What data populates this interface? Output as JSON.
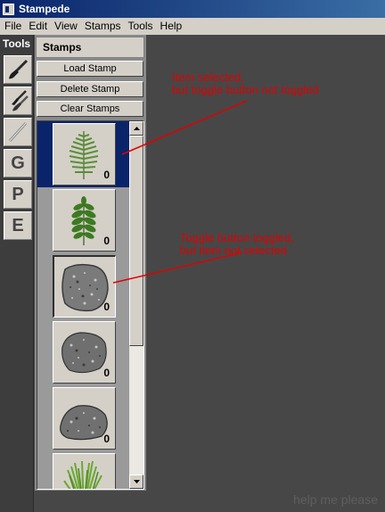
{
  "window": {
    "title": "Stampede",
    "icon": "app-icon"
  },
  "menu": [
    "File",
    "Edit",
    "View",
    "Stamps",
    "Tools",
    "Help"
  ],
  "tools": {
    "header": "Tools",
    "items": [
      {
        "name": "brush-tool",
        "icon": "brush-icon",
        "label": ""
      },
      {
        "name": "multi-brush-tool",
        "icon": "brushes-icon",
        "label": ""
      },
      {
        "name": "line-tool",
        "icon": "line-icon",
        "label": ""
      },
      {
        "name": "tool-g",
        "icon": "",
        "label": "G"
      },
      {
        "name": "tool-p",
        "icon": "",
        "label": "P"
      },
      {
        "name": "tool-e",
        "icon": "",
        "label": "E"
      }
    ]
  },
  "stamps": {
    "header": "Stamps",
    "load_label": "Load Stamp",
    "delete_label": "Delete Stamp",
    "clear_label": "Clear Stamps",
    "items": [
      {
        "image": "fern-stamp",
        "count": "0",
        "selected": true,
        "toggled": false
      },
      {
        "image": "leaf-stamp",
        "count": "0",
        "selected": false,
        "toggled": false
      },
      {
        "image": "rock-stamp",
        "count": "0",
        "selected": false,
        "toggled": true
      },
      {
        "image": "rock-stamp",
        "count": "0",
        "selected": false,
        "toggled": false
      },
      {
        "image": "rock-stamp",
        "count": "0",
        "selected": false,
        "toggled": false
      },
      {
        "image": "grass-stamp",
        "count": "",
        "selected": false,
        "toggled": false
      }
    ]
  },
  "annotations": {
    "first": {
      "line1": "Item selected,",
      "line2": "but toggle button not toggled"
    },
    "second": {
      "line1": "Toggle button toggled,",
      "line2": "but item not selected"
    }
  },
  "watermark": "help me please",
  "colors": {
    "selection": "#0a246a",
    "annotation": "#e00000",
    "background": "#474747",
    "button_face": "#d4d0c8"
  }
}
